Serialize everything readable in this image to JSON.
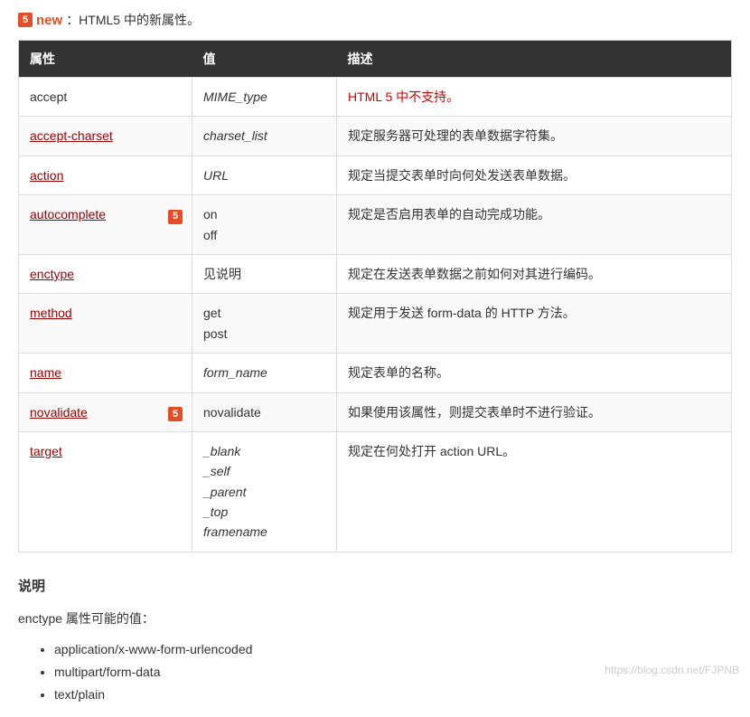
{
  "intro": {
    "icon_glyph": "5",
    "new_label": "new",
    "text": "：HTML5 中的新属性。"
  },
  "table": {
    "headers": [
      "属性",
      "值",
      "描述"
    ],
    "rows": [
      {
        "attr": "accept",
        "attr_is_link": false,
        "html5": false,
        "value": "MIME_type",
        "value_italic": true,
        "desc": "HTML 5 中不支持。",
        "desc_red": true
      },
      {
        "attr": "accept-charset",
        "attr_is_link": true,
        "html5": false,
        "value": "charset_list",
        "value_italic": true,
        "desc": "规定服务器可处理的表单数据字符集。",
        "desc_red": false
      },
      {
        "attr": "action",
        "attr_is_link": true,
        "html5": false,
        "value": "URL",
        "value_italic": true,
        "desc": "规定当提交表单时向何处发送表单数据。",
        "desc_red": false
      },
      {
        "attr": "autocomplete",
        "attr_is_link": true,
        "html5": true,
        "value": "on\noff",
        "value_italic": false,
        "desc": "规定是否启用表单的自动完成功能。",
        "desc_red": false
      },
      {
        "attr": "enctype",
        "attr_is_link": true,
        "html5": false,
        "value": "见说明",
        "value_italic": false,
        "desc": "规定在发送表单数据之前如何对其进行编码。",
        "desc_red": false
      },
      {
        "attr": "method",
        "attr_is_link": true,
        "html5": false,
        "value": "get\npost",
        "value_italic": false,
        "desc": "规定用于发送 form-data 的 HTTP 方法。",
        "desc_red": false
      },
      {
        "attr": "name",
        "attr_is_link": true,
        "html5": false,
        "value": "form_name",
        "value_italic": true,
        "desc": "规定表单的名称。",
        "desc_red": false
      },
      {
        "attr": "novalidate",
        "attr_is_link": true,
        "html5": true,
        "value": "novalidate",
        "value_italic": false,
        "desc": "如果使用该属性，则提交表单时不进行验证。",
        "desc_red": false
      },
      {
        "attr": "target",
        "attr_is_link": true,
        "html5": false,
        "value": "_blank\n_self\n_parent\n_top\nframename",
        "value_italic": true,
        "desc": "规定在何处打开 action URL。",
        "desc_red": false
      }
    ]
  },
  "notes": {
    "title": "说明",
    "subtitle": "enctype 属性可能的值：",
    "items": [
      "application/x-www-form-urlencoded",
      "multipart/form-data",
      "text/plain"
    ]
  },
  "watermark": "https://blog.csdn.net/FJPNB"
}
